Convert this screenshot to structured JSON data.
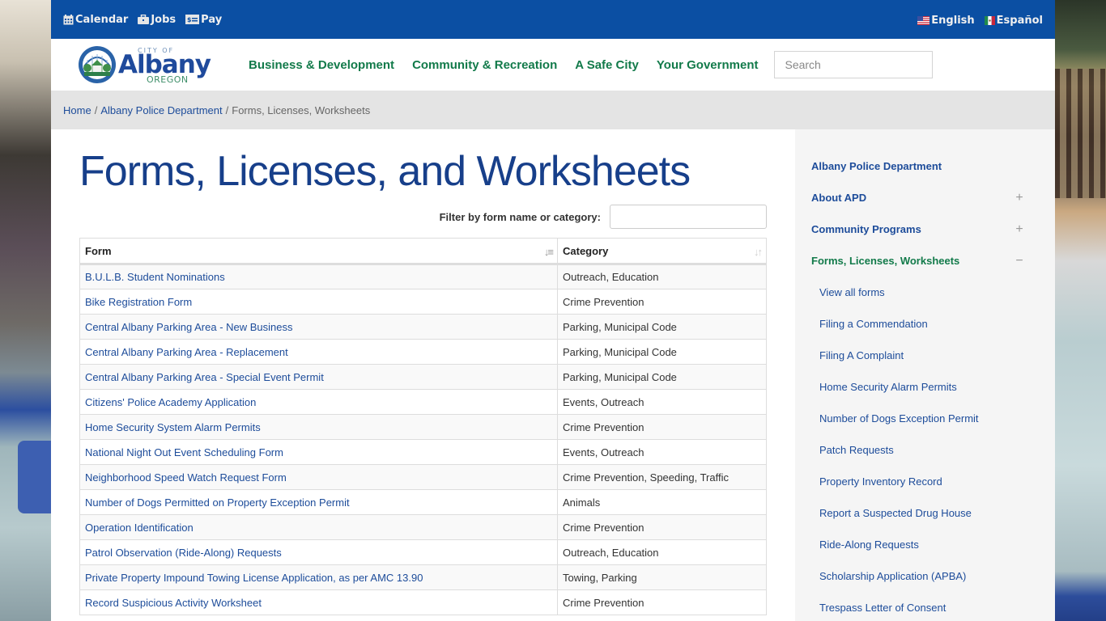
{
  "utility": {
    "calendar": "Calendar",
    "jobs": "Jobs",
    "pay": "Pay",
    "english": "English",
    "espanol": "Español"
  },
  "logo": {
    "city_of": "CITY OF",
    "name": "Albany",
    "state": "OREGON"
  },
  "nav": {
    "items": [
      "Business & Development",
      "Community & Recreation",
      "A Safe City",
      "Your Government"
    ],
    "search_placeholder": "Search"
  },
  "breadcrumb": {
    "home": "Home",
    "sep": "/",
    "parent": "Albany Police Department",
    "current": "Forms, Licenses, Worksheets"
  },
  "page": {
    "title": "Forms, Licenses, and Worksheets",
    "filter_label": "Filter by form name or category:",
    "filter_value": ""
  },
  "table": {
    "headers": {
      "form": "Form",
      "category": "Category"
    },
    "rows": [
      {
        "form": "B.U.L.B. Student Nominations",
        "category": "Outreach, Education"
      },
      {
        "form": "Bike Registration Form",
        "category": "Crime Prevention"
      },
      {
        "form": "Central Albany Parking Area - New Business",
        "category": "Parking, Municipal Code"
      },
      {
        "form": "Central Albany Parking Area - Replacement",
        "category": "Parking, Municipal Code"
      },
      {
        "form": "Central Albany Parking Area - Special Event Permit",
        "category": "Parking, Municipal Code"
      },
      {
        "form": "Citizens' Police Academy Application",
        "category": "Events, Outreach"
      },
      {
        "form": "Home Security System Alarm Permits",
        "category": "Crime Prevention"
      },
      {
        "form": "National Night Out Event Scheduling Form",
        "category": "Events, Outreach"
      },
      {
        "form": "Neighborhood Speed Watch Request Form",
        "category": "Crime Prevention, Speeding, Traffic"
      },
      {
        "form": "Number of Dogs Permitted on Property Exception Permit",
        "category": "Animals"
      },
      {
        "form": "Operation Identification",
        "category": "Crime Prevention"
      },
      {
        "form": "Patrol Observation (Ride-Along) Requests",
        "category": "Outreach, Education"
      },
      {
        "form": "Private Property Impound Towing License Application, as per AMC 13.90",
        "category": "Towing, Parking"
      },
      {
        "form": "Record Suspicious Activity Worksheet",
        "category": "Crime Prevention"
      }
    ]
  },
  "sidebar": {
    "top": "Albany Police Department",
    "sections": [
      {
        "label": "About APD",
        "toggle": "+"
      },
      {
        "label": "Community Programs",
        "toggle": "+"
      },
      {
        "label": "Forms, Licenses, Worksheets",
        "toggle": "−"
      }
    ],
    "sub_items": [
      "View all forms",
      "Filing a Commendation",
      "Filing A Complaint",
      "Home Security Alarm Permits",
      "Number of Dogs Exception Permit",
      "Patch Requests",
      "Property Inventory Record",
      "Report a Suspected Drug House",
      "Ride-Along Requests",
      "Scholarship Application (APBA)",
      "Trespass Letter of Consent"
    ]
  },
  "colors": {
    "utility_bar": "#0b4fa3",
    "nav_green": "#127a4a",
    "link_blue": "#1d4c9a",
    "title_blue": "#173f8a"
  }
}
